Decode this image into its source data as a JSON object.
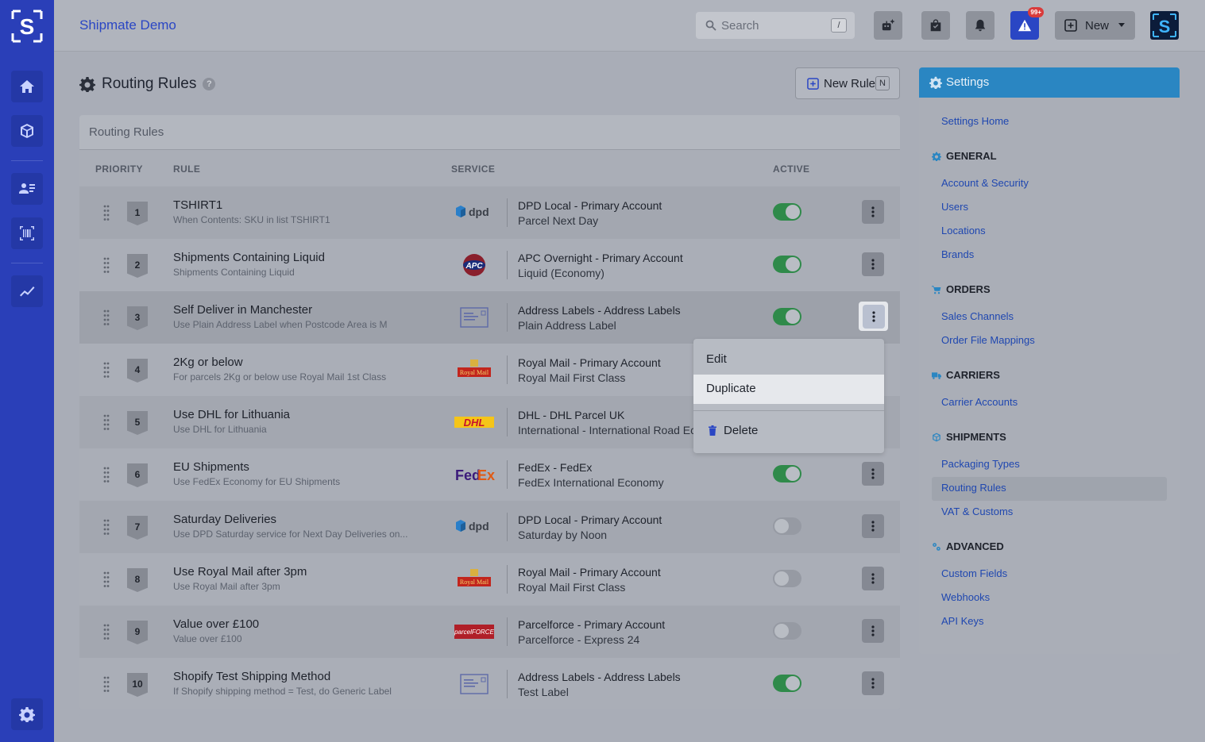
{
  "app": {
    "brand": "Shipmate Demo"
  },
  "search": {
    "placeholder": "Search",
    "shortcut": "/"
  },
  "topbar": {
    "badge": "99+",
    "new_label": "New"
  },
  "page": {
    "title": "Routing Rules",
    "help": "?",
    "new_rule_label": "New Rule",
    "new_rule_shortcut": "N"
  },
  "table": {
    "card_title": "Routing Rules",
    "columns": {
      "priority": "PRIORITY",
      "rule": "RULE",
      "service": "SERVICE",
      "active": "ACTIVE"
    },
    "rows": [
      {
        "priority": "1",
        "name": "TSHIRT1",
        "desc": "When Contents: SKU in list TSHIRT1",
        "logo": "dpd-logo",
        "account": "DPD Local - Primary Account",
        "service": "Parcel Next Day",
        "active": true
      },
      {
        "priority": "2",
        "name": "Shipments Containing Liquid",
        "desc": "Shipments Containing Liquid",
        "logo": "apc-logo",
        "account": "APC Overnight - Primary Account",
        "service": "Liquid (Economy)",
        "active": true
      },
      {
        "priority": "3",
        "name": "Self Deliver in Manchester",
        "desc": "Use Plain Address Label when Postcode Area is M",
        "logo": "address-label-logo",
        "account": "Address Labels - Address Labels",
        "service": "Plain Address Label",
        "active": true
      },
      {
        "priority": "4",
        "name": "2Kg or below",
        "desc": "For parcels 2Kg or below use Royal Mail 1st Class",
        "logo": "royal-mail-logo",
        "account": "Royal Mail - Primary Account",
        "service": "Royal Mail First Class",
        "active": true
      },
      {
        "priority": "5",
        "name": "Use DHL for Lithuania",
        "desc": "Use DHL for Lithuania",
        "logo": "dhl-logo",
        "account": "DHL - DHL Parcel UK",
        "service": "International - International Road Economy",
        "active": true
      },
      {
        "priority": "6",
        "name": "EU Shipments",
        "desc": "Use FedEx Economy for EU Shipments",
        "logo": "fedex-logo",
        "account": "FedEx - FedEx",
        "service": "FedEx International Economy",
        "active": true
      },
      {
        "priority": "7",
        "name": "Saturday Deliveries",
        "desc": "Use DPD Saturday service for Next Day Deliveries on...",
        "logo": "dpd-logo",
        "account": "DPD Local - Primary Account",
        "service": "Saturday by Noon",
        "active": false
      },
      {
        "priority": "8",
        "name": "Use Royal Mail after 3pm",
        "desc": "Use Royal Mail after 3pm",
        "logo": "royal-mail-logo",
        "account": "Royal Mail - Primary Account",
        "service": "Royal Mail First Class",
        "active": false
      },
      {
        "priority": "9",
        "name": "Value over £100",
        "desc": "Value over £100",
        "logo": "parcelforce-logo",
        "account": "Parcelforce - Primary Account",
        "service": "Parcelforce - Express 24",
        "active": false
      },
      {
        "priority": "10",
        "name": "Shopify Test Shipping Method",
        "desc": "If Shopify shipping method = Test, do Generic Label",
        "logo": "address-label-logo",
        "account": "Address Labels - Address Labels",
        "service": "Test Label",
        "active": true
      }
    ]
  },
  "logos": {
    "dpd": "dpd",
    "apc": "APC",
    "royal_mail": "Royal Mail",
    "dhl": "DHL",
    "fedex_a": "Fed",
    "fedex_b": "Ex",
    "parcelforce": "parcelFORCE"
  },
  "menu": {
    "items": [
      "Edit",
      "Duplicate",
      "Delete"
    ],
    "selected": "Duplicate"
  },
  "settings": {
    "title": "Settings",
    "home": "Settings Home",
    "sections": [
      {
        "title": "GENERAL",
        "links": [
          "Account & Security",
          "Users",
          "Locations",
          "Brands"
        ]
      },
      {
        "title": "ORDERS",
        "links": [
          "Sales Channels",
          "Order File Mappings"
        ]
      },
      {
        "title": "CARRIERS",
        "links": [
          "Carrier Accounts"
        ]
      },
      {
        "title": "SHIPMENTS",
        "links": [
          "Packaging Types",
          "Routing Rules",
          "VAT & Customs"
        ]
      },
      {
        "title": "ADVANCED",
        "links": [
          "Custom Fields",
          "Webhooks",
          "API Keys"
        ]
      }
    ],
    "active_link": "Routing Rules"
  },
  "colors": {
    "nav": "#2a3fb8",
    "accent": "#2a86c2",
    "toggle_on": "#2f8a4a",
    "alert": "#2a46c4"
  }
}
